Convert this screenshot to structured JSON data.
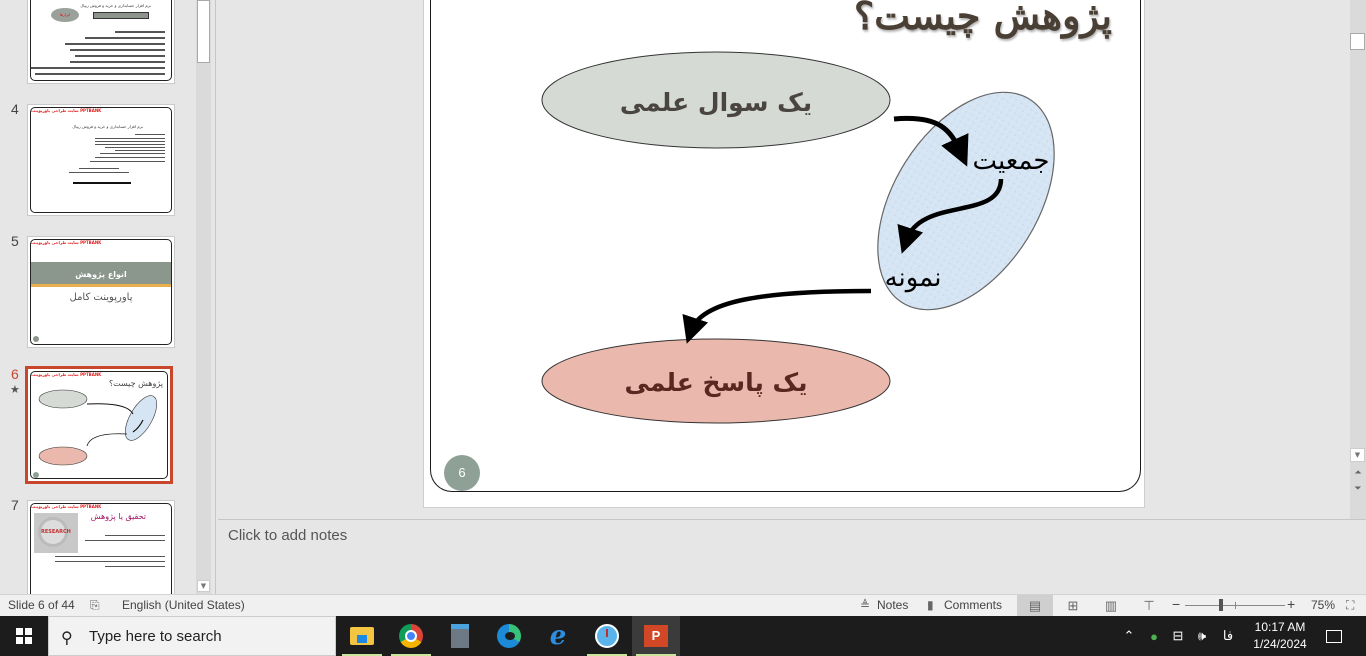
{
  "thumbnails": [
    {
      "number": "",
      "title": "نرم افزار حسابداری و خرید و فروش زیپال",
      "badge": "ابزارها",
      "lines": [
        "ما خودمان به آسانی:",
        "خرید الاکترونیکی خود را ثبت نمایید.",
        "پرداخت ها و خرید و پرداخت های الکترونیکی خود را ثبت نمایید.",
        "حسابها و اسناد دریافتی و پرداختی روزانه خود را ثبت نمایید.",
        "چکهای صادره و دریافتی حسابهای را ثبت نمایید."
      ]
    },
    {
      "number": "4",
      "header": "سایت طراحی پاورپوینت  PPTBANK",
      "title": "نرم افزار حسابداری و خرید و فروش زیپال",
      "footer": "کلیک به پاورپوینت بروید بیشتر"
    },
    {
      "number": "5",
      "header": "سایت طراحی پاورپوینت  PPTBANK",
      "banner": "انواع پژوهش",
      "subtitle": "پاورپوینت کامل"
    },
    {
      "number": "6",
      "header": "سایت طراحی پاورپوینت  PPTBANK",
      "title": "پژوهش چیست؟",
      "selected": true,
      "has_animation": true
    },
    {
      "number": "7",
      "header": "سایت طراحی پاورپوینت  PPTBANK",
      "title": "تحقیق یا پژوهش",
      "image_label": "RESEARCH",
      "bullets": [
        "تحقیق راهی برای کشف حقیقت",
        "فرایند منظم به منظور جستجو و کشف حقیقت",
        "تحقیق فرایندی است برنامه ریزی شده هوشیارانه، نظام مند (systematic) و قابل اعتماد برای یافتن حقایق یا فهم عمیق مسایل"
      ]
    }
  ],
  "slide": {
    "title": "پژوهش چیست؟",
    "nodes": {
      "question": "یک سوال علمی",
      "population": "جمعیت",
      "sample": "نمونه",
      "answer": "یک پاسخ علمی"
    },
    "slide_number": "6",
    "colors": {
      "question_fill": "#d5dad5",
      "population_fill": "#d6e5f3",
      "answer_fill": "#ebb8ad",
      "number_badge": "#8fa196",
      "title": "#4a3f35"
    }
  },
  "notes": {
    "placeholder": "Click to add notes"
  },
  "statusbar": {
    "slide_counter": "Slide 6 of 44",
    "language": "English (United States)",
    "notes_label": "Notes",
    "comments_label": "Comments",
    "zoom_level": "75%",
    "zoom_value_percent": 75
  },
  "taskbar": {
    "search_placeholder": "Type here to search",
    "apps": [
      "File Explorer",
      "Google Chrome",
      "Calculator",
      "Microsoft Edge",
      "Internet Explorer",
      "Clock",
      "PowerPoint"
    ],
    "active_app": "PowerPoint",
    "language_indicator": "فا",
    "time": "10:17 AM",
    "date": "1/24/2024"
  }
}
